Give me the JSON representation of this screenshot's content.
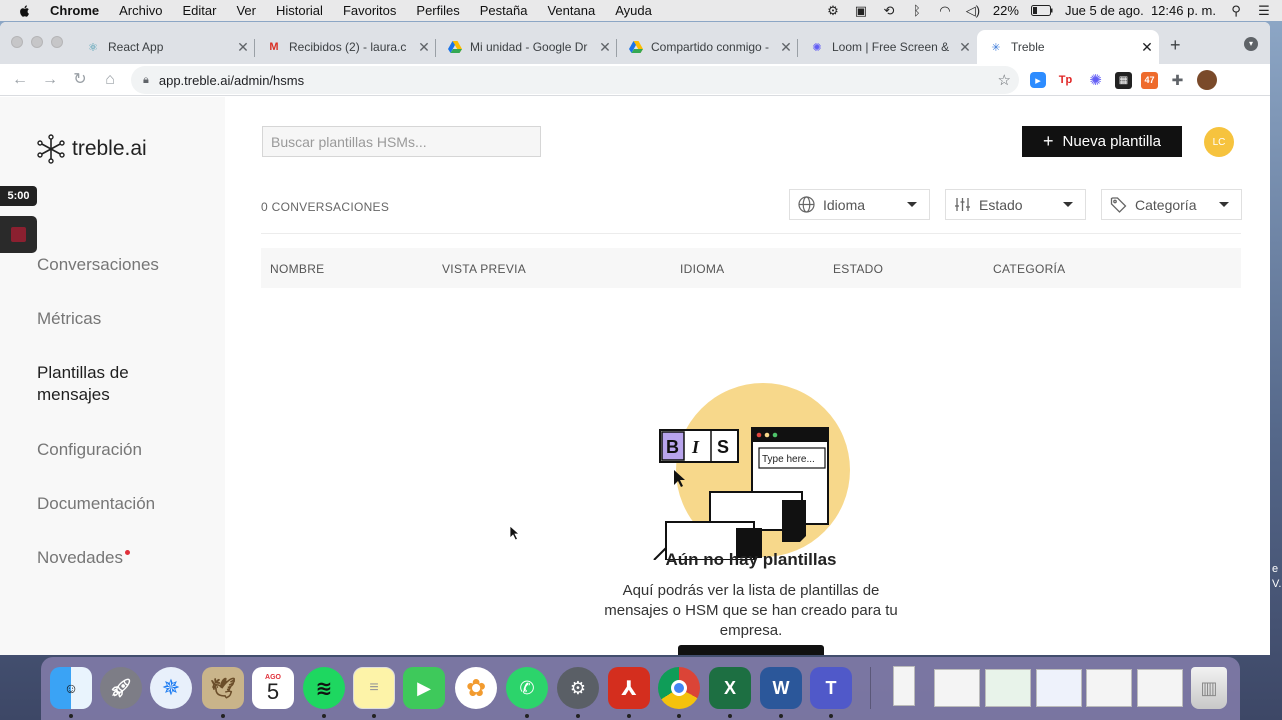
{
  "menubar": {
    "app": "Chrome",
    "items": [
      "Archivo",
      "Editar",
      "Ver",
      "Historial",
      "Favoritos",
      "Perfiles",
      "Pestaña",
      "Ventana",
      "Ayuda"
    ],
    "battery": "22%",
    "datetime": "Jue 5 de ago.  12:46 p. m."
  },
  "tabs": [
    {
      "title": "React App",
      "icon": "react-icon",
      "color": "#2f8fa8"
    },
    {
      "title": "Recibidos (2) - laura.c",
      "icon": "gmail-icon",
      "color": "#d93025"
    },
    {
      "title": "Mi unidad - Google Dr",
      "icon": "google-drive-icon",
      "color": "#1a73e8"
    },
    {
      "title": "Compartido conmigo -",
      "icon": "google-drive-icon",
      "color": "#1a73e8"
    },
    {
      "title": "Loom | Free Screen &",
      "icon": "loom-icon",
      "color": "#625df5"
    },
    {
      "title": "Treble",
      "icon": "treble-icon",
      "color": "#3d7bd9"
    }
  ],
  "url": "app.treble.ai/admin/hsms",
  "sidebar": {
    "logo_text": "treble.ai",
    "timer": "5:00",
    "items": [
      {
        "label": "Conversaciones"
      },
      {
        "label": "Métricas"
      },
      {
        "label": "Plantillas de mensajes"
      },
      {
        "label": "Configuración"
      },
      {
        "label": "Documentación"
      },
      {
        "label": "Novedades"
      }
    ]
  },
  "main": {
    "search_placeholder": "Buscar plantillas HSMs...",
    "new_button": "Nueva plantilla",
    "avatar_initials": "LC",
    "count_label": "0 CONVERSACIONES",
    "filters": [
      {
        "label": "Idioma",
        "icon": "globe-icon"
      },
      {
        "label": "Estado",
        "icon": "sliders-icon"
      },
      {
        "label": "Categoría",
        "icon": "tag-icon"
      }
    ],
    "columns": [
      "NOMBRE",
      "VISTA PREVIA",
      "IDIOMA",
      "ESTADO",
      "CATEGORÍA"
    ],
    "empty": {
      "title": "Aún no hay plantillas",
      "description": "Aquí podrás ver la lista de plantillas de mensajes o HSM que se han creado para tu empresa.",
      "illustration_text": "Type here...",
      "toolbar_letters": [
        "B",
        "I",
        "S"
      ]
    }
  },
  "dock": {
    "calendar_month": "AGO",
    "calendar_day": "5"
  },
  "desktop_text": "e\nV.",
  "colors": {
    "accent_yellow": "#f6c33e",
    "primary_black": "#111111",
    "sidebar_bg": "#f8f8f8",
    "notification_dot": "#e0303a"
  }
}
